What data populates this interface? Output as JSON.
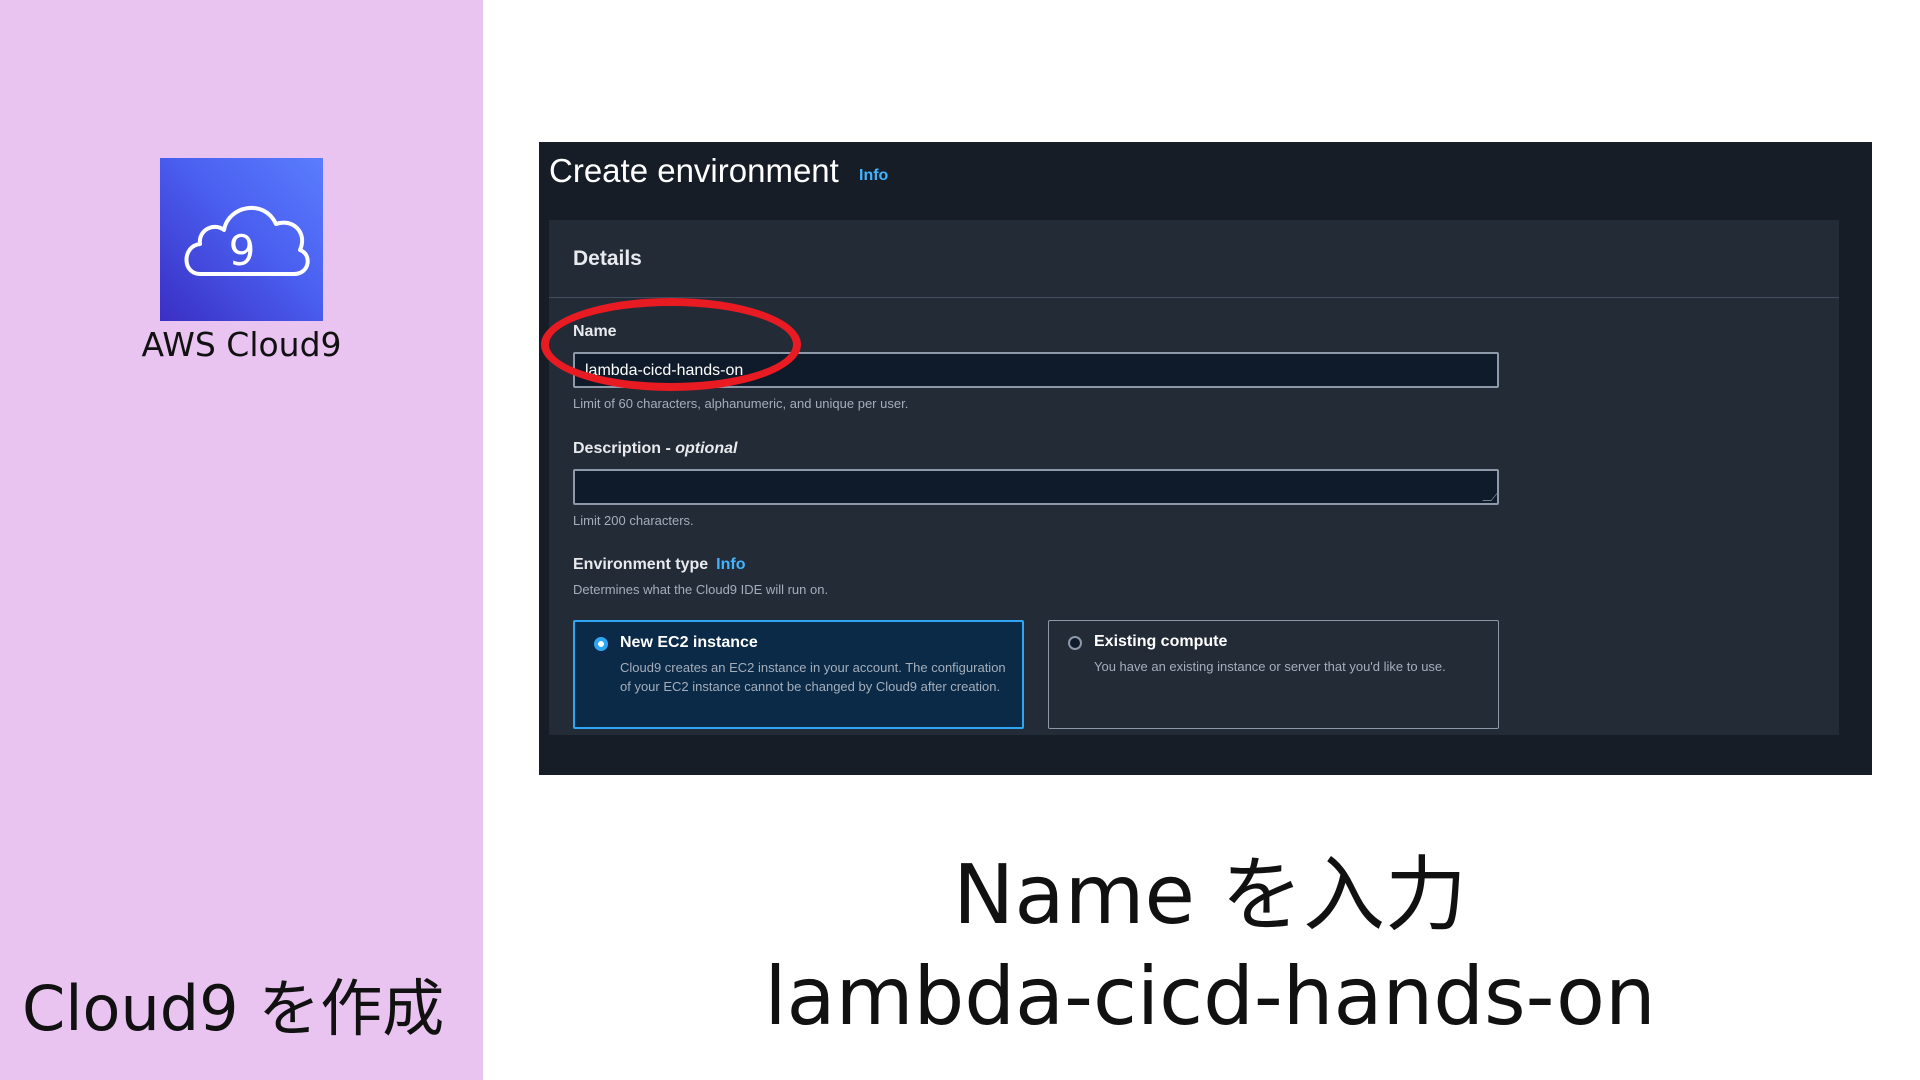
{
  "sidebar": {
    "logo_icon": "aws-cloud9-icon",
    "logo_digit": "9",
    "logo_caption": "AWS Cloud9",
    "slide_title": "Cloud9 を作成"
  },
  "screenshot": {
    "title": "Create environment",
    "title_info": "Info",
    "panel_header": "Details",
    "name": {
      "label": "Name",
      "value": "lambda-cicd-hands-on",
      "hint": "Limit of 60 characters, alphanumeric, and unique per user."
    },
    "description": {
      "label": "Description - ",
      "label_optional": "optional",
      "value": "",
      "hint": "Limit 200 characters."
    },
    "environment_type": {
      "label": "Environment type",
      "info": "Info",
      "hint": "Determines what the Cloud9 IDE will run on.",
      "options": [
        {
          "title": "New EC2 instance",
          "description": "Cloud9 creates an EC2 instance in your account. The configuration of your EC2 instance cannot be changed by Cloud9 after creation.",
          "selected": true
        },
        {
          "title": "Existing compute",
          "description": "You have an existing instance or server that you'd like to use.",
          "selected": false
        }
      ]
    }
  },
  "captions": {
    "line1": "Name を入力",
    "line2": "lambda-cicd-hands-on"
  },
  "colors": {
    "sidebar_bg": "#e9c4f1",
    "console_bg": "#161d26",
    "panel_bg": "#232b37",
    "accent_blue": "#2ea6f5",
    "info_link": "#42b4ff",
    "highlight_red": "#e81a22"
  }
}
